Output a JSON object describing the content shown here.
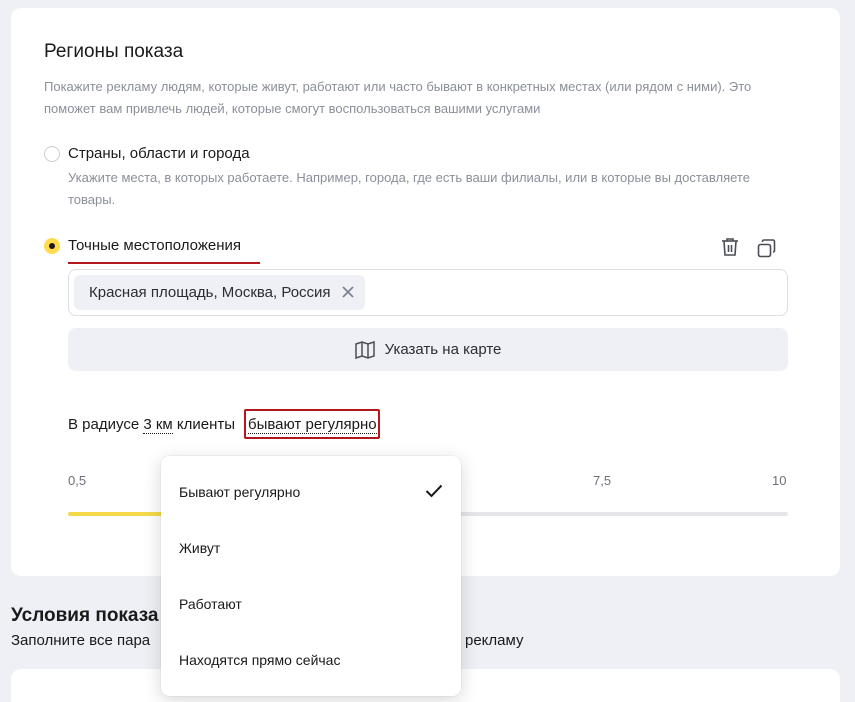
{
  "regions": {
    "title": "Регионы показа",
    "description": "Покажите рекламу людям, которые живут, работают или часто бывают в конкретных местах (или рядом с ними). Это поможет вам привлечь людей, которые смогут воспользоваться вашими услугами",
    "options": [
      {
        "label": "Страны, области и города",
        "description": "Укажите места, в которых работаете. Например, города, где есть ваши филиалы, или в которые вы доставляете товары.",
        "selected": false
      },
      {
        "label": "Точные местоположения",
        "selected": true
      }
    ],
    "location_chip": "Красная площадь, Москва, Россия",
    "map_button": "Указать на карте",
    "radius": {
      "prefix": "В радиусе",
      "value": "3 км",
      "clients_word": "клиенты",
      "frequency": "бывают регулярно"
    },
    "slider": {
      "ticks": [
        "0,5",
        "7,5",
        "10"
      ],
      "min": 0.5,
      "max": 10,
      "value": 3
    },
    "icons": {
      "delete": "trash-icon",
      "copy": "copy-icon",
      "remove_chip": "close-icon",
      "map": "map-icon",
      "selected": "checkmark-icon"
    }
  },
  "conditions": {
    "title_visible": "Условия показа",
    "subtitle_left": "Заполните все пара",
    "subtitle_right": "ть рекламу"
  },
  "frequency_dropdown": {
    "items": [
      {
        "label": "Бывают регулярно",
        "checked": true
      },
      {
        "label": "Живут",
        "checked": false
      },
      {
        "label": "Работают",
        "checked": false
      },
      {
        "label": "Находятся прямо сейчас",
        "checked": false
      }
    ]
  },
  "colors": {
    "accent_yellow": "#ffdb4d",
    "highlight_red": "#b3171c",
    "muted_text": "#8a8f99",
    "background": "#eef0f5"
  }
}
